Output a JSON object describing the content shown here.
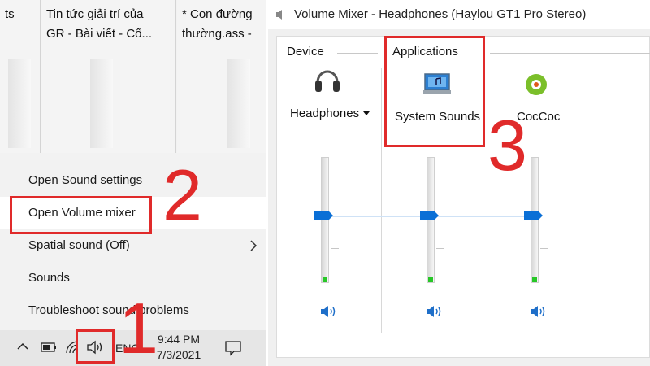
{
  "thumbnails": [
    {
      "title": "ts"
    },
    {
      "title": "Tin tức giải trí của\nGR - Bài viết - Cố..."
    },
    {
      "title": "* Con đường\nthường.ass -"
    }
  ],
  "context_menu": {
    "items": [
      {
        "label": "Open Sound settings"
      },
      {
        "label": "Open Volume mixer"
      },
      {
        "label": "Spatial sound (Off)"
      },
      {
        "label": "Sounds"
      },
      {
        "label": "Troubleshoot sound problems"
      }
    ]
  },
  "taskbar": {
    "language": "ENG",
    "time": "9:44 PM",
    "date": "7/3/2021"
  },
  "mixer": {
    "title": "Volume Mixer - Headphones (Haylou GT1 Pro Stereo)",
    "device_group": "Device",
    "apps_group": "Applications",
    "device_name": "Headphones",
    "apps": [
      {
        "name": "System Sounds"
      },
      {
        "name": "CocCoc"
      }
    ],
    "levels": {
      "headphones": 0.5,
      "system_sounds": 0.5,
      "coccoc": 0.5
    }
  },
  "annotations": {
    "step1": "1",
    "step2": "2",
    "step3": "3"
  },
  "colors": {
    "annotation": "#e02a2a",
    "slider": "#0a6fd6",
    "level": "#27c727"
  }
}
